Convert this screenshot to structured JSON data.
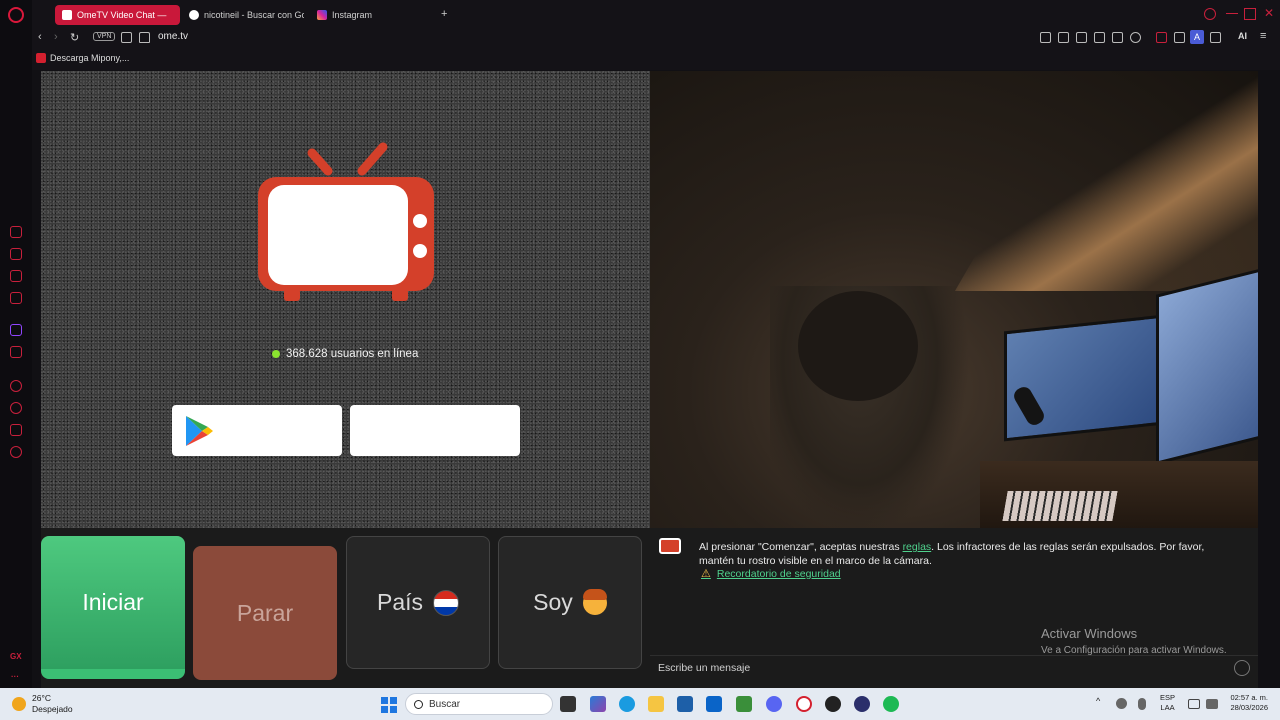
{
  "browser": {
    "tabs": [
      {
        "label": "OmeTV Video Chat —",
        "active": true,
        "icon": "ometv-icon"
      },
      {
        "label": "nicotineil - Buscar con Go",
        "active": false,
        "icon": "google-icon"
      },
      {
        "label": "Instagram",
        "active": false,
        "icon": "instagram-icon"
      }
    ],
    "vpn_label": "VPN",
    "url": "ome.tv",
    "ai_label": "AI",
    "profile_letter": "A",
    "bookmark": "Descarga Mipony,...",
    "gx_label": "GX",
    "accent": "#c9183a"
  },
  "page": {
    "online_text": "368.628 usuarios en línea",
    "buttons": {
      "start": "Iniciar",
      "stop": "Parar",
      "country": "País",
      "gender": "Soy"
    },
    "notice_prefix": "Al presionar \"Comenzar\", aceptas nuestras ",
    "notice_link": "reglas",
    "notice_suffix": ". Los infractores de las reglas serán expulsados. Por favor, mantén tu rostro visible en el marco de la cámara.",
    "safety_link": "Recordatorio de seguridad",
    "message_placeholder": "Escribe un mensaje",
    "brand_color": "#d4402a",
    "start_color": "#3bbf74"
  },
  "watermark": {
    "line1": "Activar Windows",
    "line2": "Ve a Configuración para activar Windows."
  },
  "taskbar": {
    "weather_temp": "26°C",
    "weather_desc": "Despejado",
    "search_placeholder": "Buscar",
    "lang_top": "ESP",
    "lang_bottom": "LAA",
    "time": "02:57 a. m.",
    "date": "28/03/2026"
  }
}
